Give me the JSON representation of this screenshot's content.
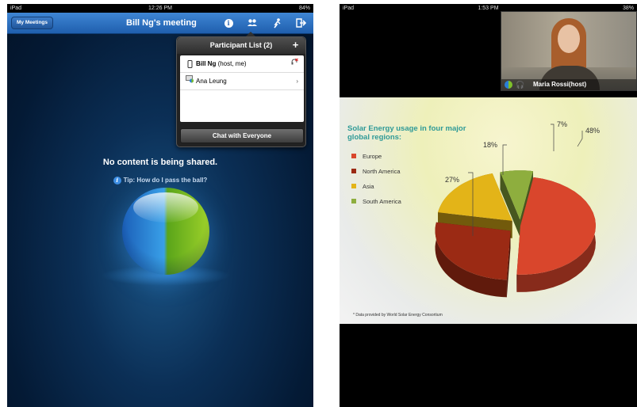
{
  "left": {
    "status": {
      "device": "iPad",
      "time": "12:26 PM",
      "battery": "84%"
    },
    "nav": {
      "my_meetings": "My Meetings",
      "title": "Bill Ng's meeting",
      "icons": [
        "info-icon",
        "participants-icon",
        "pass-ball-icon",
        "leave-icon"
      ]
    },
    "participants": {
      "title": "Participant List (2)",
      "add": "+",
      "rows": [
        {
          "name": "Bill Ng",
          "suffix": " (host, me)",
          "icon": "phone-icon",
          "right_icon": "mute-icon"
        },
        {
          "name": "Ana Leung",
          "suffix": "",
          "icon": "presenter-icon",
          "right_icon": "chevron-right-icon"
        }
      ],
      "chat_button": "Chat with Everyone"
    },
    "no_content": "No content is being shared.",
    "tip": "Tip: How do I pass the ball?"
  },
  "right": {
    "status": {
      "device": "iPad",
      "time": "1:53 PM",
      "battery": "38%"
    },
    "video": {
      "name": "Maria Rossi(host)"
    },
    "slide": {
      "footnote": "* Data provided by World Solar Energy Consortium"
    }
  },
  "chart_data": {
    "type": "pie",
    "title": "Solar Energy usage in four major global regions:",
    "series": [
      {
        "name": "Europe",
        "value": 48,
        "label": "48%",
        "color": "#d9462c"
      },
      {
        "name": "North America",
        "value": 27,
        "label": "27%",
        "color": "#9b2a14"
      },
      {
        "name": "Asia",
        "value": 18,
        "label": "18%",
        "color": "#e3b418"
      },
      {
        "name": "South America",
        "value": 7,
        "label": "7%",
        "color": "#8eae3e"
      }
    ],
    "legend_position": "left"
  }
}
